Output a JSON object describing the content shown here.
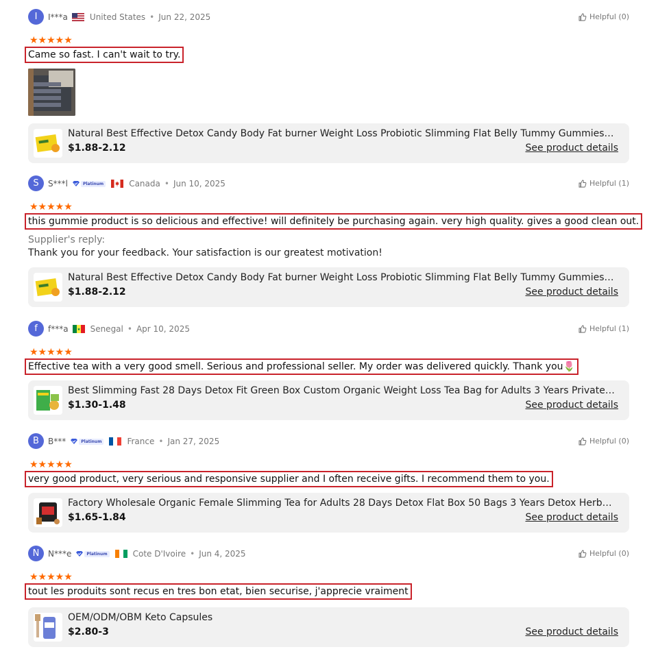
{
  "reviews": [
    {
      "avatar_letter": "I",
      "user": "I***a",
      "platinum": "",
      "flag": "us",
      "country": "United States",
      "date": "Jun 22, 2025",
      "helpful": "Helpful (0)",
      "rating": 5,
      "text": "Came so fast. I can't wait to try.",
      "reply_label": "",
      "reply_text": "",
      "product": {
        "title": "Natural Best Effective Detox Candy Body Fat burner Weight Loss Probiotic Slimming Flat Belly Tummy Gummies Candy Weig...",
        "price": "$1.88-2.12",
        "details": "See product details"
      }
    },
    {
      "avatar_letter": "S",
      "user": "S***l",
      "platinum": "Platinum",
      "flag": "ca",
      "country": "Canada",
      "date": "Jun 10, 2025",
      "helpful": "Helpful (1)",
      "rating": 5,
      "text": "this gummie product is so delicious and effective! will definitely be purchasing again. very high quality. gives a good clean out.",
      "reply_label": "Supplier's reply:",
      "reply_text": "Thank you for your feedback. Your satisfaction is our greatest motivation!",
      "product": {
        "title": "Natural Best Effective Detox Candy Body Fat burner Weight Loss Probiotic Slimming Flat Belly Tummy Gummies Candy Weig...",
        "price": "$1.88-2.12",
        "details": "See product details"
      }
    },
    {
      "avatar_letter": "f",
      "user": "f***a",
      "platinum": "",
      "flag": "sn",
      "country": "Senegal",
      "date": "Apr 10, 2025",
      "helpful": "Helpful (1)",
      "rating": 5,
      "text": "Effective tea with a very good smell. Serious and professional seller. My order was delivered quickly. Thank you🌷",
      "reply_label": "",
      "reply_text": "",
      "product": {
        "title": "Best Slimming Fast 28 Days Detox Fit Green Box Custom Organic Weight Loss Tea Bag for Adults 3 Years Private Label",
        "price": "$1.30-1.48",
        "details": "See product details"
      }
    },
    {
      "avatar_letter": "B",
      "user": "B***",
      "platinum": "Platinum",
      "flag": "fr",
      "country": "France",
      "date": "Jan 27, 2025",
      "helpful": "Helpful (0)",
      "rating": 5,
      "text": "very good product, very serious and responsive supplier and I often receive gifts. I recommend them to you.",
      "reply_label": "",
      "reply_text": "",
      "product": {
        "title": "Factory Wholesale Organic Female Slimming Tea for Adults 28 Days Detox Flat Box 50 Bags 3 Years Detox Herbal Tea for B...",
        "price": "$1.65-1.84",
        "details": "See product details"
      }
    },
    {
      "avatar_letter": "N",
      "user": "N***e",
      "platinum": "Platinum",
      "flag": "ci",
      "country": "Cote D'Ivoire",
      "date": "Jun 4, 2025",
      "helpful": "Helpful (0)",
      "rating": 5,
      "text": "tout les produits sont recus en tres bon etat, bien securise, j'apprecie vraiment",
      "reply_label": "",
      "reply_text": "",
      "product": {
        "title": "OEM/ODM/OBM Keto Capsules",
        "price": "$2.80-3",
        "details": "See product details"
      }
    }
  ],
  "colors": {
    "avatar": "#5468d8",
    "star": "#ff6a00",
    "highlight_border": "#c9222a",
    "card_bg": "#f1f1f1"
  },
  "icons": {
    "helpful": "thumbs-up-icon",
    "star": "star-icon",
    "verified": "platinum-badge-icon"
  }
}
